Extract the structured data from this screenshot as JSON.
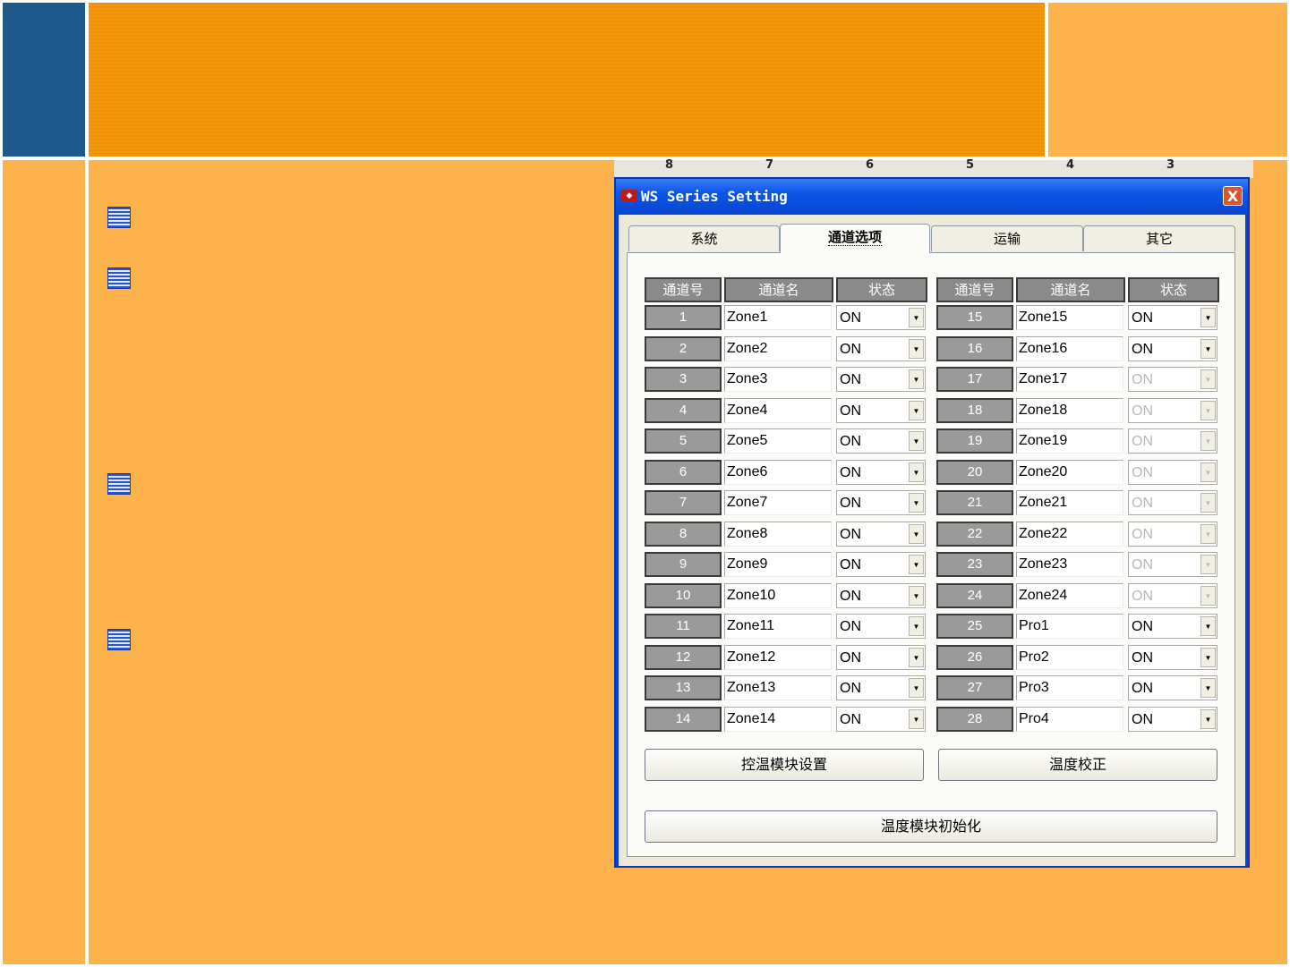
{
  "background_axis": [
    "8",
    "7",
    "6",
    "5",
    "4",
    "3"
  ],
  "dialog": {
    "title": "WS Series Setting",
    "close": "X",
    "tabs": [
      "系统",
      "通道选项",
      "运输",
      "其它"
    ],
    "active_tab": 1,
    "headers": {
      "num": "通道号",
      "name": "通道名",
      "state": "状态"
    },
    "left_rows": [
      {
        "num": "1",
        "name": "Zone1",
        "state": "ON",
        "enabled": true
      },
      {
        "num": "2",
        "name": "Zone2",
        "state": "ON",
        "enabled": true
      },
      {
        "num": "3",
        "name": "Zone3",
        "state": "ON",
        "enabled": true
      },
      {
        "num": "4",
        "name": "Zone4",
        "state": "ON",
        "enabled": true
      },
      {
        "num": "5",
        "name": "Zone5",
        "state": "ON",
        "enabled": true
      },
      {
        "num": "6",
        "name": "Zone6",
        "state": "ON",
        "enabled": true
      },
      {
        "num": "7",
        "name": "Zone7",
        "state": "ON",
        "enabled": true
      },
      {
        "num": "8",
        "name": "Zone8",
        "state": "ON",
        "enabled": true
      },
      {
        "num": "9",
        "name": "Zone9",
        "state": "ON",
        "enabled": true
      },
      {
        "num": "10",
        "name": "Zone10",
        "state": "ON",
        "enabled": true
      },
      {
        "num": "11",
        "name": "Zone11",
        "state": "ON",
        "enabled": true
      },
      {
        "num": "12",
        "name": "Zone12",
        "state": "ON",
        "enabled": true
      },
      {
        "num": "13",
        "name": "Zone13",
        "state": "ON",
        "enabled": true
      },
      {
        "num": "14",
        "name": "Zone14",
        "state": "ON",
        "enabled": true
      }
    ],
    "right_rows": [
      {
        "num": "15",
        "name": "Zone15",
        "state": "ON",
        "enabled": true
      },
      {
        "num": "16",
        "name": "Zone16",
        "state": "ON",
        "enabled": true
      },
      {
        "num": "17",
        "name": "Zone17",
        "state": "ON",
        "enabled": false
      },
      {
        "num": "18",
        "name": "Zone18",
        "state": "ON",
        "enabled": false
      },
      {
        "num": "19",
        "name": "Zone19",
        "state": "ON",
        "enabled": false
      },
      {
        "num": "20",
        "name": "Zone20",
        "state": "ON",
        "enabled": false
      },
      {
        "num": "21",
        "name": "Zone21",
        "state": "ON",
        "enabled": false
      },
      {
        "num": "22",
        "name": "Zone22",
        "state": "ON",
        "enabled": false
      },
      {
        "num": "23",
        "name": "Zone23",
        "state": "ON",
        "enabled": false
      },
      {
        "num": "24",
        "name": "Zone24",
        "state": "ON",
        "enabled": false
      },
      {
        "num": "25",
        "name": "Pro1",
        "state": "ON",
        "enabled": true
      },
      {
        "num": "26",
        "name": "Pro2",
        "state": "ON",
        "enabled": true
      },
      {
        "num": "27",
        "name": "Pro3",
        "state": "ON",
        "enabled": true
      },
      {
        "num": "28",
        "name": "Pro4",
        "state": "ON",
        "enabled": true
      }
    ],
    "buttons": {
      "temp_module_settings": "控温模块设置",
      "temp_calibration": "温度校正",
      "temp_module_init": "温度模块初始化"
    }
  },
  "colors": {
    "banner": "#f3960a",
    "slide_bg": "#fdb24b",
    "corner_blue": "#1f5a8c"
  }
}
